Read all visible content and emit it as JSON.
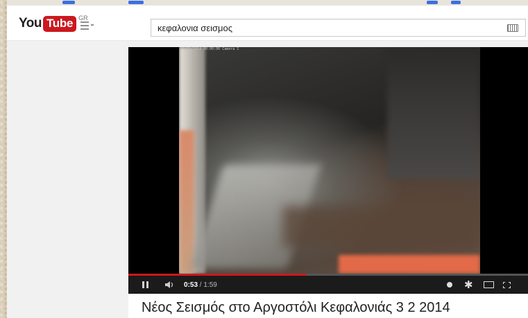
{
  "header": {
    "logo_you": "You",
    "logo_tube": "Tube",
    "country_code": "GR",
    "guide_icon": "guide-menu-icon"
  },
  "search": {
    "query": "κεφαλονια σεισμος",
    "keyboard_icon": "keyboard-icon"
  },
  "player": {
    "overlay_stamp": "00/03/2014 00:00:00 Camera 1",
    "progress_fraction": 0.445,
    "current_time": "0:53",
    "separator": " / ",
    "duration": "1:59",
    "icons": [
      "pause-icon",
      "volume-icon",
      "info-icon",
      "gear-icon",
      "theater-icon",
      "fullscreen-icon"
    ]
  },
  "video": {
    "title": "Νέος Σεισμός στο Αργοστόλι Κεφαλονιάς 3 2 2014"
  },
  "colors": {
    "brand_red": "#cc181e",
    "control_bar": "#1b1b1b",
    "page_bg": "#f1f1f1"
  }
}
